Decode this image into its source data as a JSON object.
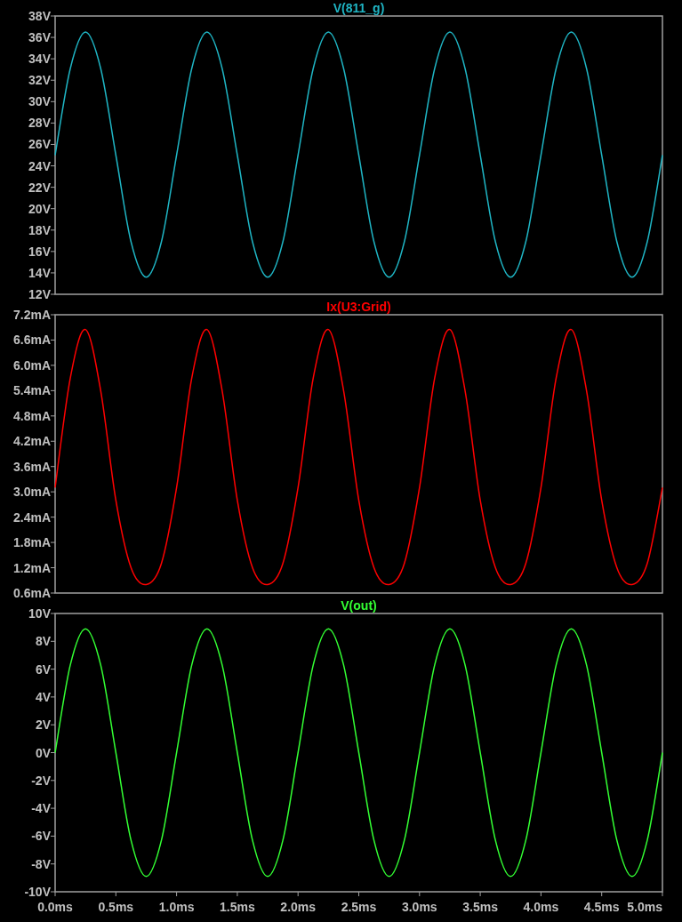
{
  "panels": [
    {
      "chart_data": {
        "type": "line",
        "xlim": [
          0,
          5
        ],
        "ylim": [
          12,
          38
        ],
        "x": [
          0,
          0.125,
          0.25,
          0.375,
          0.5,
          0.625,
          0.75,
          0.875,
          1,
          1.125,
          1.25,
          1.375,
          1.5,
          1.625,
          1.75,
          1.875,
          2,
          2.125,
          2.25,
          2.375,
          2.5,
          2.625,
          2.75,
          2.875,
          3,
          3.125,
          3.25,
          3.375,
          3.5,
          3.625,
          3.75,
          3.875,
          4,
          4.125,
          4.25,
          4.375,
          4.5,
          4.625,
          4.75,
          4.875,
          5
        ],
        "yticks": [
          {
            "value": 12,
            "label": "12V"
          },
          {
            "value": 14,
            "label": "14V"
          },
          {
            "value": 16,
            "label": "16V"
          },
          {
            "value": 18,
            "label": "18V"
          },
          {
            "value": 20,
            "label": "20V"
          },
          {
            "value": 22,
            "label": "22V"
          },
          {
            "value": 24,
            "label": "24V"
          },
          {
            "value": 26,
            "label": "26V"
          },
          {
            "value": 28,
            "label": "28V"
          },
          {
            "value": 30,
            "label": "30V"
          },
          {
            "value": 32,
            "label": "32V"
          },
          {
            "value": 34,
            "label": "34V"
          },
          {
            "value": 36,
            "label": "36V"
          },
          {
            "value": 38,
            "label": "38V"
          }
        ],
        "series": [
          {
            "name": "V(811_g)",
            "color": "#1fb5c4",
            "values": [
              25,
              33.1,
              36.5,
              33.1,
              25,
              16.9,
              13.6,
              16.9,
              25,
              33.1,
              36.5,
              33.1,
              25,
              16.9,
              13.6,
              16.9,
              25,
              33.1,
              36.5,
              33.1,
              25,
              16.9,
              13.6,
              16.9,
              25,
              33.1,
              36.5,
              33.1,
              25,
              16.9,
              13.6,
              16.9,
              25,
              33.1,
              36.5,
              33.1,
              25,
              16.9,
              13.6,
              16.9,
              25
            ]
          }
        ]
      }
    },
    {
      "chart_data": {
        "type": "line",
        "xlim": [
          0,
          5
        ],
        "ylim": [
          0.6,
          7.2
        ],
        "x": [
          0,
          0.125,
          0.25,
          0.375,
          0.5,
          0.625,
          0.75,
          0.875,
          1,
          1.125,
          1.25,
          1.375,
          1.5,
          1.625,
          1.75,
          1.875,
          2,
          2.125,
          2.25,
          2.375,
          2.5,
          2.625,
          2.75,
          2.875,
          3,
          3.125,
          3.25,
          3.375,
          3.5,
          3.625,
          3.75,
          3.875,
          4,
          4.125,
          4.25,
          4.375,
          4.5,
          4.625,
          4.75,
          4.875,
          5
        ],
        "yticks": [
          {
            "value": 0.6,
            "label": "0.6mA"
          },
          {
            "value": 1.2,
            "label": "1.2mA"
          },
          {
            "value": 1.8,
            "label": "1.8mA"
          },
          {
            "value": 2.4,
            "label": "2.4mA"
          },
          {
            "value": 3.0,
            "label": "3.0mA"
          },
          {
            "value": 3.6,
            "label": "3.6mA"
          },
          {
            "value": 4.2,
            "label": "4.2mA"
          },
          {
            "value": 4.8,
            "label": "4.8mA"
          },
          {
            "value": 5.4,
            "label": "5.4mA"
          },
          {
            "value": 6.0,
            "label": "6.0mA"
          },
          {
            "value": 6.6,
            "label": "6.6mA"
          },
          {
            "value": 7.2,
            "label": "7.2mA"
          }
        ],
        "series": [
          {
            "name": "Ix(U3:Grid)",
            "color": "#ff0000",
            "values": [
              3.1,
              5.7,
              6.85,
              5.4,
              2.8,
              1.2,
              0.8,
              1.3,
              3.1,
              5.7,
              6.85,
              5.4,
              2.8,
              1.2,
              0.8,
              1.3,
              3.1,
              5.7,
              6.85,
              5.4,
              2.8,
              1.2,
              0.8,
              1.3,
              3.1,
              5.7,
              6.85,
              5.4,
              2.8,
              1.2,
              0.8,
              1.3,
              3.1,
              5.7,
              6.85,
              5.4,
              2.8,
              1.2,
              0.8,
              1.3,
              3.1
            ]
          }
        ]
      }
    },
    {
      "chart_data": {
        "type": "line",
        "xlim": [
          0,
          5
        ],
        "ylim": [
          -10,
          10
        ],
        "x": [
          0,
          0.125,
          0.25,
          0.375,
          0.5,
          0.625,
          0.75,
          0.875,
          1,
          1.125,
          1.25,
          1.375,
          1.5,
          1.625,
          1.75,
          1.875,
          2,
          2.125,
          2.25,
          2.375,
          2.5,
          2.625,
          2.75,
          2.875,
          3,
          3.125,
          3.25,
          3.375,
          3.5,
          3.625,
          3.75,
          3.875,
          4,
          4.125,
          4.25,
          4.375,
          4.5,
          4.625,
          4.75,
          4.875,
          5
        ],
        "xticks": [
          {
            "value": 0,
            "label": "0.0ms"
          },
          {
            "value": 0.5,
            "label": "0.5ms"
          },
          {
            "value": 1,
            "label": "1.0ms"
          },
          {
            "value": 1.5,
            "label": "1.5ms"
          },
          {
            "value": 2,
            "label": "2.0ms"
          },
          {
            "value": 2.5,
            "label": "2.5ms"
          },
          {
            "value": 3,
            "label": "3.0ms"
          },
          {
            "value": 3.5,
            "label": "3.5ms"
          },
          {
            "value": 4,
            "label": "4.0ms"
          },
          {
            "value": 4.5,
            "label": "4.5ms"
          },
          {
            "value": 5,
            "label": "5.0ms"
          }
        ],
        "yticks": [
          {
            "value": -10,
            "label": "-10V"
          },
          {
            "value": -8,
            "label": "-8V"
          },
          {
            "value": -6,
            "label": "-6V"
          },
          {
            "value": -4,
            "label": "-4V"
          },
          {
            "value": -2,
            "label": "-2V"
          },
          {
            "value": 0,
            "label": "0V"
          },
          {
            "value": 2,
            "label": "2V"
          },
          {
            "value": 4,
            "label": "4V"
          },
          {
            "value": 6,
            "label": "6V"
          },
          {
            "value": 8,
            "label": "8V"
          },
          {
            "value": 10,
            "label": "10V"
          }
        ],
        "series": [
          {
            "name": "V(out)",
            "color": "#33ff33",
            "values": [
              0,
              6.3,
              8.9,
              6.3,
              0,
              -6.3,
              -8.9,
              -6.3,
              0,
              6.3,
              8.9,
              6.3,
              0,
              -6.3,
              -8.9,
              -6.3,
              0,
              6.3,
              8.9,
              6.3,
              0,
              -6.3,
              -8.9,
              -6.3,
              0,
              6.3,
              8.9,
              6.3,
              0,
              -6.3,
              -8.9,
              -6.3,
              0,
              6.3,
              8.9,
              6.3,
              0,
              -6.3,
              -8.9,
              -6.3,
              0
            ]
          }
        ]
      }
    }
  ]
}
